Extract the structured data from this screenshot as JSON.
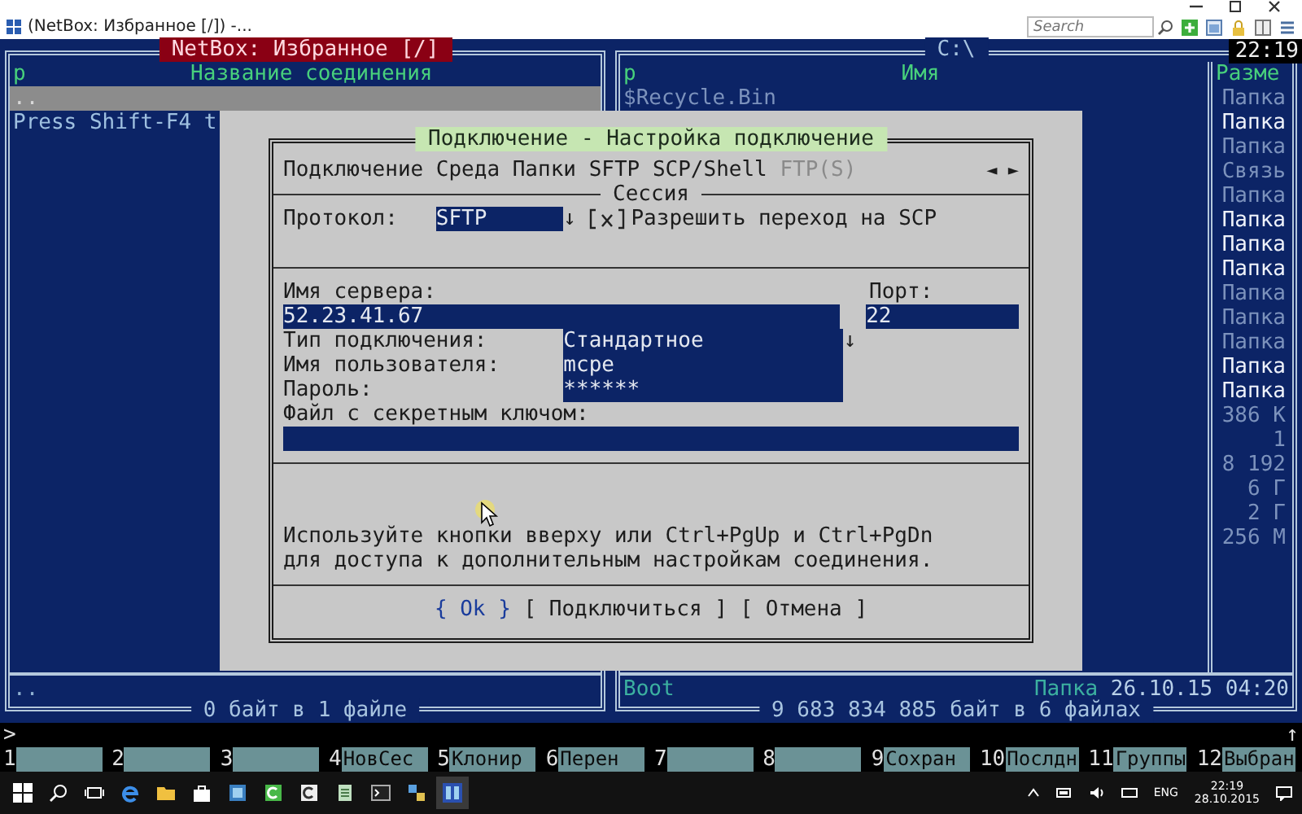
{
  "window": {
    "tab_title": "(NetBox: Избранное [/]) -...",
    "search": {
      "placeholder": "Search"
    }
  },
  "clock": "22:19",
  "left_panel": {
    "title": "NetBox: Избранное [/]",
    "columns": [
      "р",
      "Название соединения"
    ],
    "rows": [
      {
        "text": "..",
        "selected": true
      },
      {
        "text": "Press Shift-F4 t",
        "selected": false
      }
    ],
    "info": "..",
    "footer": "0 байт в 1 файле"
  },
  "right_panel": {
    "title": "C:\\",
    "columns": [
      "р",
      "Имя",
      "Разме"
    ],
    "rows": [
      {
        "name": "$Recycle.Bin",
        "size": "Папка",
        "hidden": true
      },
      {
        "size": "Папка",
        "hidden": false
      },
      {
        "size": "Папка",
        "hidden": true
      },
      {
        "size": "Связь",
        "hidden": true
      },
      {
        "size": "Папка",
        "hidden": true
      },
      {
        "size": "Папка",
        "hidden": false
      },
      {
        "size": "Папка",
        "hidden": false
      },
      {
        "size": "Папка",
        "hidden": false
      },
      {
        "size": "Папка",
        "hidden": true
      },
      {
        "size": "Папка",
        "hidden": true
      },
      {
        "size": "Папка",
        "hidden": true
      },
      {
        "size": "Папка",
        "hidden": false
      },
      {
        "size": "Папка",
        "hidden": false
      },
      {
        "size": "386 К",
        "hidden": true
      },
      {
        "size": "1",
        "hidden": true
      },
      {
        "size": "8 192",
        "hidden": true
      },
      {
        "size": "6 Г",
        "hidden": true
      },
      {
        "size": "2 Г",
        "hidden": true
      },
      {
        "size": "256 М",
        "hidden": true
      }
    ],
    "info": {
      "name": "Boot",
      "size": "Папка",
      "date": "26.10.15 04:20"
    },
    "footer": "9 683 834 885 байт в 6 файлах"
  },
  "dialog": {
    "title": "Подключение - Настройка подключение",
    "tabs": [
      {
        "label": "Подключение",
        "disabled": false
      },
      {
        "label": "Среда",
        "disabled": false
      },
      {
        "label": "Папки",
        "disabled": false
      },
      {
        "label": "SFTP",
        "disabled": false
      },
      {
        "label": "SCP/Shell",
        "disabled": false
      },
      {
        "label": "FTP(S)",
        "disabled": true
      }
    ],
    "scroll_arrows": "◄ ►",
    "section": "Сессия",
    "protocol": {
      "label": "Протокол:",
      "value": "SFTP",
      "arrow": "↓"
    },
    "scp_fallback": {
      "label": "Разрешить переход на SCP",
      "checked": true
    },
    "server": {
      "label": "Имя сервера:",
      "value": "52.23.41.67"
    },
    "port": {
      "label": "Порт:",
      "value": "22"
    },
    "connection_type": {
      "label": "Тип подключения:",
      "value": "Стандартное",
      "arrow": "↓"
    },
    "username": {
      "label": "Имя пользователя:",
      "value": "mcpe"
    },
    "password": {
      "label": "Пароль:",
      "value": "******"
    },
    "key_file": {
      "label": "Файл с секретным ключом:"
    },
    "hint": [
      "Используйте кнопки вверху или Ctrl+PgUp и Ctrl+PgDn",
      "для доступа к дополнительным настройкам соединения."
    ],
    "buttons": [
      {
        "label": "{ Ok }",
        "selected": true
      },
      {
        "label": "[ Подключиться ]",
        "selected": false
      },
      {
        "label": "[ Отмена ]",
        "selected": false
      }
    ]
  },
  "command_line": {
    "prompt": ">",
    "history_arrow": "↑"
  },
  "keys": [
    {
      "number": "1"
    },
    {
      "number": "2"
    },
    {
      "number": "3"
    },
    {
      "number": "4",
      "label": "НовСес"
    },
    {
      "number": "5",
      "label": "Клонир"
    },
    {
      "number": "6",
      "label": "Перен"
    },
    {
      "number": "7"
    },
    {
      "number": "8"
    },
    {
      "number": "9",
      "label": "Сохран"
    },
    {
      "number": "10",
      "label": "Послдн"
    },
    {
      "number": "11",
      "label": "Группы"
    },
    {
      "number": "12",
      "label": "Выбран"
    }
  ],
  "taskbar": {
    "language": "ENG",
    "time": "22:19",
    "date": "28.10.2015"
  }
}
